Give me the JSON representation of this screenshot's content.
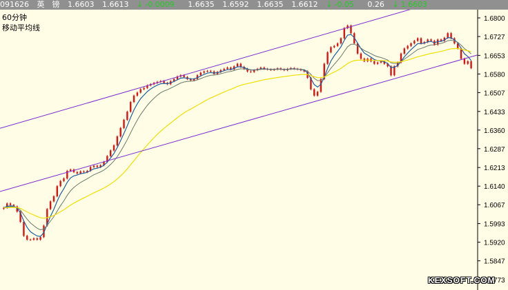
{
  "quote_bar": {
    "code": "091626",
    "name": "英　镑",
    "fields": [
      "1.6603",
      "1.6613"
    ],
    "change": "-0.0009",
    "prices": [
      "1.6635",
      "1.6592",
      "1.6635",
      "1.6612"
    ],
    "pct_change": "-0.05",
    "volume": "0.26",
    "last": "1.6603",
    "down_color": "#22cc22",
    "down_arrow": "↓"
  },
  "chart_labels": {
    "period": "60分钟",
    "indicator": "移动平均线"
  },
  "watermark": "KEXSOFT.COM",
  "chart_data": {
    "type": "line",
    "description_of_elements": "candlestick price series with moving averages and two parallel channel lines",
    "ylim": [
      1.5773,
      1.68
    ],
    "y_ticks": [
      "1.6800",
      "1.6727",
      "1.6653",
      "1.6580",
      "1.6507",
      "1.6433",
      "1.6360",
      "1.6287",
      "1.6213",
      "1.6140",
      "1.6067",
      "1.5993",
      "1.5920",
      "1.5847",
      "1.5773"
    ],
    "colors": {
      "background": "#fffde6",
      "candle": "#dd1111",
      "ma_fast": "#1a5fa0",
      "ma_mid": "#6a7a6a",
      "ma_slow": "#f0e000",
      "channel": "#7a2bd0",
      "grid_edge": "#000000"
    },
    "channel_upper": [
      [
        0,
        1.6371
      ],
      [
        113,
        1.68
      ]
    ],
    "channel_lower": [
      [
        0,
        1.6123
      ],
      [
        138,
        1.664
      ]
    ],
    "close": [
      1.6055,
      1.6072,
      1.6066,
      1.606,
      1.604,
      1.6,
      1.5945,
      1.593,
      1.593,
      1.5935,
      1.593,
      1.594,
      1.5985,
      1.605,
      1.608,
      1.61,
      1.614,
      1.616,
      1.617,
      1.62,
      1.6205,
      1.6195,
      1.619,
      1.6198,
      1.6195,
      1.62,
      1.6215,
      1.622,
      1.6215,
      1.6222,
      1.6235,
      1.6258,
      1.628,
      1.63,
      1.6335,
      1.6368,
      1.64,
      1.6432,
      1.647,
      1.6495,
      1.6507,
      1.652,
      1.6525,
      1.6535,
      1.654,
      1.6545,
      1.6549,
      1.6552,
      1.6545,
      1.654,
      1.6552,
      1.656,
      1.657,
      1.6575,
      1.6568,
      1.656,
      1.6555,
      1.656,
      1.6575,
      1.6585,
      1.659,
      1.6592,
      1.659,
      1.658,
      1.6588,
      1.6595,
      1.66,
      1.6605,
      1.6598,
      1.661,
      1.662,
      1.6608,
      1.66,
      1.659,
      1.6588,
      1.6595,
      1.66,
      1.6605,
      1.66,
      1.6598,
      1.6596,
      1.6598,
      1.6602,
      1.6598,
      1.6595,
      1.66,
      1.6603,
      1.66,
      1.6598,
      1.6595,
      1.659,
      1.6565,
      1.652,
      1.6495,
      1.651,
      1.656,
      1.662,
      1.6665,
      1.6685,
      1.669,
      1.67,
      1.672,
      1.676,
      1.677,
      1.674,
      1.67,
      1.666,
      1.664,
      1.663,
      1.664,
      1.663,
      1.662,
      1.6625,
      1.663,
      1.662,
      1.661,
      1.6575,
      1.661,
      1.6625,
      1.666,
      1.668,
      1.669,
      1.67,
      1.671,
      1.672,
      1.67,
      1.6705,
      1.6715,
      1.671,
      1.6695,
      1.6715,
      1.671,
      1.6722,
      1.674,
      1.672,
      1.67,
      1.668,
      1.664,
      1.662,
      1.663,
      1.6603
    ]
  }
}
